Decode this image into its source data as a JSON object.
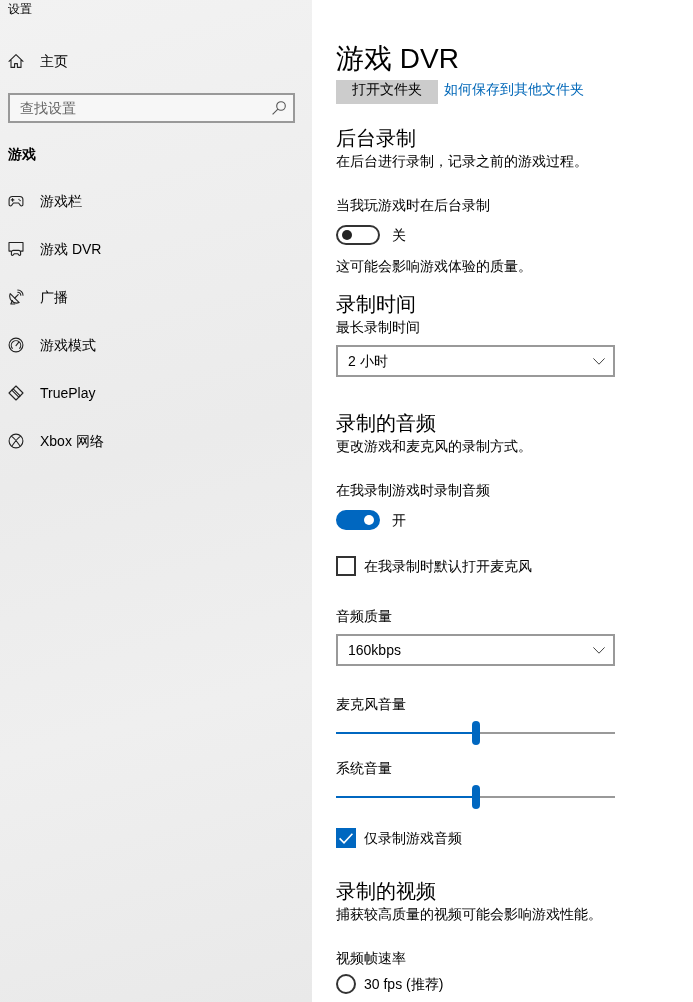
{
  "window": {
    "title": "设置"
  },
  "sidebar": {
    "home": {
      "label": "主页"
    },
    "search": {
      "placeholder": "查找设置"
    },
    "section_title": "游戏",
    "items": [
      {
        "kind": "gamebar",
        "label": "游戏栏",
        "selected": false
      },
      {
        "kind": "dvr",
        "label": "游戏 DVR",
        "selected": false
      },
      {
        "kind": "broadcast",
        "label": "广播",
        "selected": false
      },
      {
        "kind": "gamemode",
        "label": "游戏模式",
        "selected": false
      },
      {
        "kind": "trueplay",
        "label": "TruePlay",
        "selected": false
      },
      {
        "kind": "xbox",
        "label": "Xbox 网络",
        "selected": false
      }
    ]
  },
  "page": {
    "title": "游戏 DVR",
    "open_folder_button": "打开文件夹",
    "help_link": "如何保存到其他文件夹"
  },
  "sections": [
    {
      "heading": "后台录制",
      "description": "在后台进行录制，记录之前的游戏过程。",
      "settings": [
        {
          "kind": "toggle",
          "label": "当我玩游戏时在后台录制",
          "on": false,
          "state_text": "关",
          "note": "这可能会影响游戏体验的质量。"
        }
      ]
    },
    {
      "heading": "录制时间",
      "settings": [
        {
          "kind": "dropdown",
          "label": "最长录制时间",
          "value": "2 小时"
        }
      ]
    },
    {
      "heading": "录制的音频",
      "description": "更改游戏和麦克风的录制方式。",
      "settings": [
        {
          "kind": "toggle",
          "label": "在我录制游戏时录制音频",
          "on": true,
          "state_text": "开"
        },
        {
          "kind": "checkbox",
          "label": "在我录制时默认打开麦克风",
          "checked": false
        },
        {
          "kind": "dropdown",
          "label": "音频质量",
          "value": "160kbps"
        },
        {
          "kind": "slider",
          "label": "麦克风音量",
          "level": 0.5
        },
        {
          "kind": "slider",
          "label": "系统音量",
          "level": 0.5
        },
        {
          "kind": "checkbox",
          "label": "仅录制游戏音频",
          "checked": true
        }
      ]
    },
    {
      "heading": "录制的视频",
      "description": "捕获较高质量的视频可能会影响游戏性能。",
      "settings": [
        {
          "kind": "radio_group",
          "label": "视频帧速率",
          "options": [
            {
              "label": "30 fps (推荐)",
              "selected": false
            }
          ]
        }
      ]
    }
  ]
}
